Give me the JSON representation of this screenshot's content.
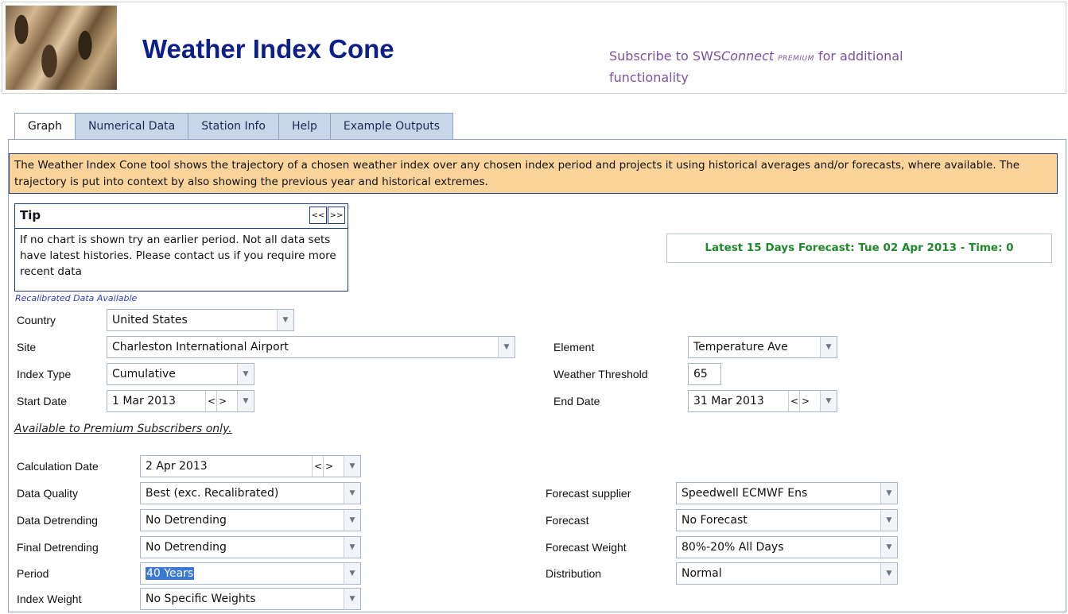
{
  "header": {
    "title": "Weather Index Cone",
    "subscribe_prefix": "Subscribe to SWS",
    "subscribe_brand": "Connect",
    "subscribe_premium": "PREMIUM",
    "subscribe_suffix": " for additional functionality"
  },
  "tabs": [
    {
      "label": "Graph",
      "active": true
    },
    {
      "label": "Numerical Data"
    },
    {
      "label": "Station Info"
    },
    {
      "label": "Help"
    },
    {
      "label": "Example Outputs"
    }
  ],
  "info_text": "The Weather Index Cone tool shows the trajectory of a chosen weather index over any chosen index period and projects it using historical averages and/or forecasts, where available. The trajectory is put into context by also showing the previous year and historical extremes.",
  "tip": {
    "title": "Tip",
    "prev": "<<",
    "next": ">>",
    "text": "If no chart is shown try an earlier period. Not all data sets have latest histories. Please contact us if you require more recent data"
  },
  "forecast_badge": "Latest 15 Days Forecast: Tue 02 Apr 2013 - Time: 0",
  "recalibrated_note": "Recalibrated Data Available",
  "form": {
    "country": {
      "label": "Country",
      "value": "United States"
    },
    "site": {
      "label": "Site",
      "value": "Charleston International Airport"
    },
    "index_type": {
      "label": "Index Type",
      "value": "Cumulative"
    },
    "start_date": {
      "label": "Start Date",
      "value": "1 Mar 2013"
    },
    "element": {
      "label": "Element",
      "value": "Temperature Ave"
    },
    "weather_threshold": {
      "label": "Weather Threshold",
      "value": "65"
    },
    "end_date": {
      "label": "End Date",
      "value": "31 Mar 2013"
    }
  },
  "premium_note": "Available to Premium Subscribers only.",
  "premium_form": {
    "calculation_date": {
      "label": "Calculation Date",
      "value": "2 Apr 2013"
    },
    "data_quality": {
      "label": "Data Quality",
      "value": "Best (exc. Recalibrated)"
    },
    "data_detrending": {
      "label": "Data Detrending",
      "value": "No Detrending"
    },
    "final_detrending": {
      "label": "Final Detrending",
      "value": "No Detrending"
    },
    "period": {
      "label": "Period",
      "value": "40 Years"
    },
    "index_weight": {
      "label": "Index Weight",
      "value": "No Specific Weights"
    },
    "forecast_supplier": {
      "label": "Forecast supplier",
      "value": "Speedwell ECMWF Ens"
    },
    "forecast": {
      "label": "Forecast",
      "value": "No Forecast"
    },
    "forecast_weight": {
      "label": "Forecast Weight",
      "value": "80%-20% All Days"
    },
    "distribution": {
      "label": "Distribution",
      "value": "Normal"
    }
  },
  "controls": {
    "prev": "<",
    "next": ">",
    "dropdown": "▼"
  }
}
